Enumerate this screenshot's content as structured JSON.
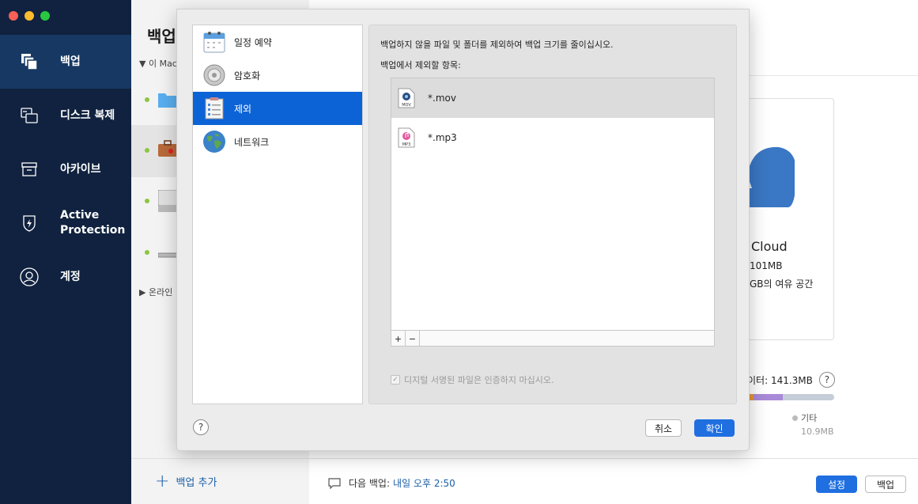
{
  "sidebar": {
    "items": [
      {
        "label": "백업",
        "icon": "copy-stack-icon",
        "active": true
      },
      {
        "label": "디스크 복제",
        "icon": "disk-clone-icon",
        "active": false
      },
      {
        "label": "아카이브",
        "icon": "archive-box-icon",
        "active": false
      },
      {
        "label": "Active Protection",
        "icon": "shield-bolt-icon",
        "active": false
      },
      {
        "label": "계정",
        "icon": "user-circle-icon",
        "active": false
      }
    ]
  },
  "middle": {
    "title": "백업",
    "this_mac_label": "▼ 이 Mac",
    "online_label": "▶ 온라인",
    "add_backup_label": "백업 추가"
  },
  "destination": {
    "name": "Cloud",
    "size": "101MB",
    "free": "GB의 여유 공간",
    "data_text": "이터: 141.3MB",
    "other_label": "기타",
    "other_size": "10.9MB"
  },
  "bottom": {
    "next_backup_label": "다음 백업:",
    "next_backup_time": "내일 오후 2:50",
    "settings_label": "설정",
    "backup_label": "백업"
  },
  "dialog": {
    "categories": [
      {
        "label": "일정 예약",
        "icon": "calendar-icon"
      },
      {
        "label": "암호화",
        "icon": "lock-icon"
      },
      {
        "label": "제외",
        "icon": "checklist-icon",
        "selected": true
      },
      {
        "label": "네트워크",
        "icon": "globe-icon"
      }
    ],
    "description": "백업하지 않을 파일 및 폴더를 제외하여 백업 크기를 줄이십시오.",
    "list_label": "백업에서 제외할 항목:",
    "exclusions": [
      {
        "label": "*.mov",
        "icon": "mov-file-icon",
        "selected": true
      },
      {
        "label": "*.mp3",
        "icon": "mp3-file-icon",
        "selected": false
      }
    ],
    "add_symbol": "+",
    "remove_symbol": "−",
    "cert_label": "디지털 서명된 파일은 인증하지 마십시오.",
    "help_symbol": "?",
    "cancel_label": "취소",
    "ok_label": "확인"
  },
  "colors": {
    "sidebar_bg": "#10223f",
    "sidebar_active": "#173863",
    "accent": "#1f6fe0",
    "selection": "#0c63d6"
  }
}
